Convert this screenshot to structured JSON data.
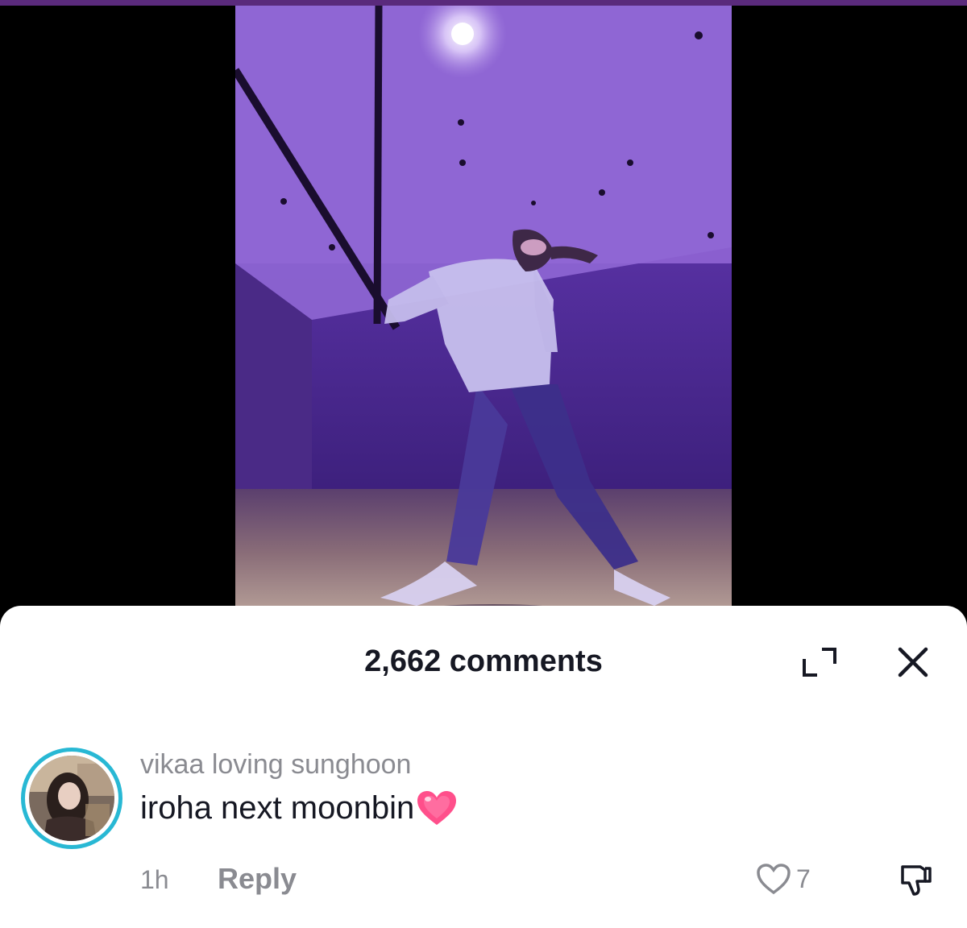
{
  "video": {
    "description_icon": "dance-video-thumbnail"
  },
  "comments_panel": {
    "title": "2,662 comments",
    "expand_icon": "expand-icon",
    "close_icon": "close-icon"
  },
  "comment": {
    "username": "vikaa loving sunghoon",
    "text": "iroha next moonbin",
    "emoji": "heart-emoji",
    "time": "1h",
    "reply_label": "Reply",
    "like_count": "7",
    "like_icon": "heart-outline-icon",
    "dislike_icon": "thumbs-down-icon"
  },
  "colors": {
    "avatar_ring": "#28b8d4",
    "heart": "#ff4f8b",
    "muted_text": "#8a8b91",
    "primary_text": "#161823"
  }
}
